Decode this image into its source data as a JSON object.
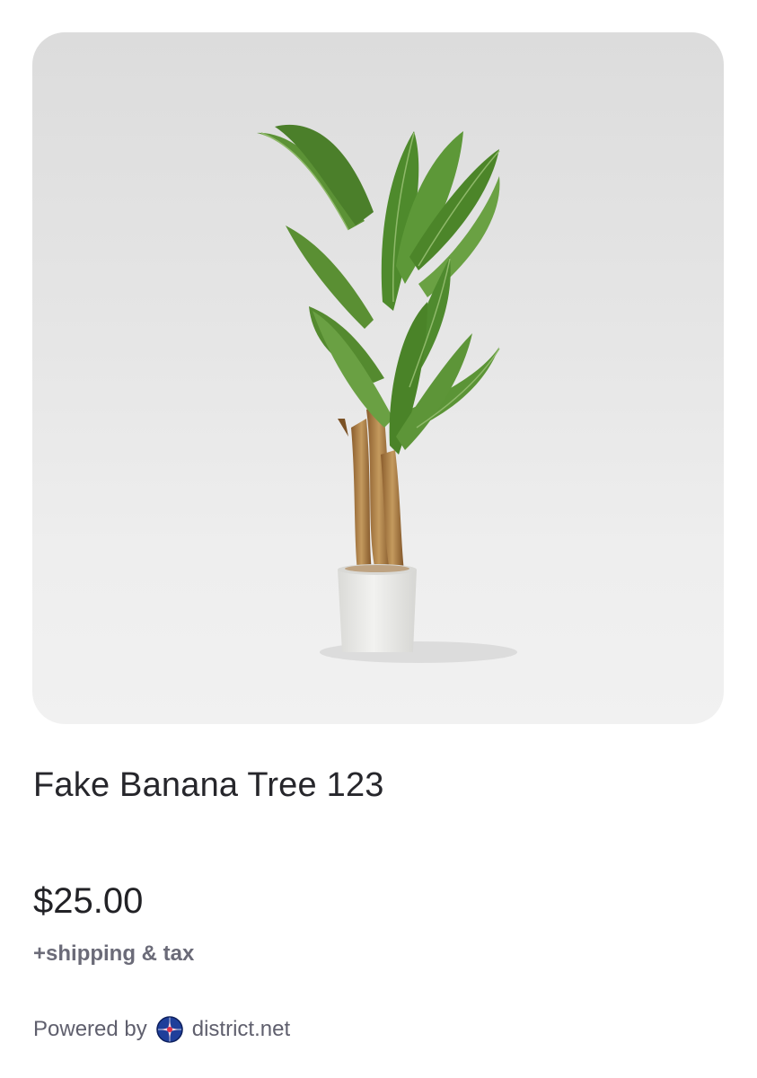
{
  "product": {
    "image_alt": "Fake banana tree in white pot",
    "title": "Fake Banana Tree 123",
    "price": "$25.00",
    "shipping_note": "+shipping & tax"
  },
  "footer": {
    "powered_by_label": "Powered by",
    "brand_name": "district.net",
    "brand_icon": "district-globe-icon"
  },
  "colors": {
    "image_background": "#e6e6e6",
    "title_text": "#26262b",
    "muted_text": "#6b6b78",
    "leaf_green": "#4f8a2e",
    "trunk_brown": "#a7763e",
    "pot_white": "#ececea",
    "brand_blue": "#1f3f9a"
  }
}
